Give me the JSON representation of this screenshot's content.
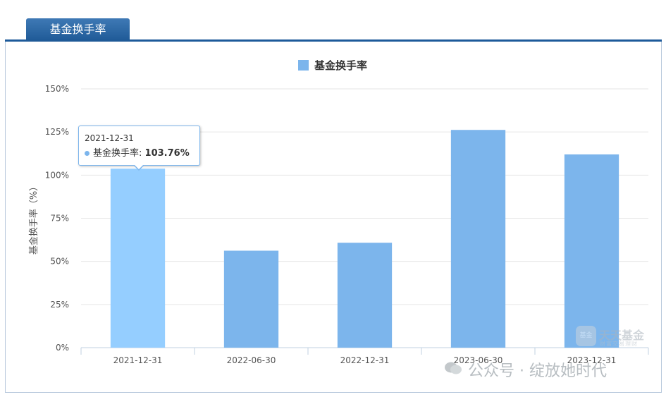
{
  "tab": {
    "label": "基金换手率"
  },
  "chart_data": {
    "type": "bar",
    "legend": "基金换手率",
    "legend_position": "top-center",
    "ylabel": "基金换手率（%）",
    "categories": [
      "2021-12-31",
      "2022-06-30",
      "2022-12-31",
      "2023-06-30",
      "2023-12-31"
    ],
    "series": [
      {
        "name": "基金换手率",
        "values": [
          103.76,
          56.2,
          60.8,
          126.2,
          112.0
        ]
      }
    ],
    "ylim": [
      0,
      150
    ],
    "yticks": [
      0,
      25,
      50,
      75,
      100,
      125,
      150
    ],
    "ytick_labels": [
      "0%",
      "25%",
      "50%",
      "75%",
      "100%",
      "125%",
      "150%"
    ],
    "grid": true,
    "bar_color": "#7cb5ec",
    "highlight_color": "#95ceff",
    "highlight_index": 0
  },
  "tooltip": {
    "date": "2021-12-31",
    "series": "基金换手率:",
    "value": "103.76%"
  },
  "watermarks": {
    "brand": "天天基金",
    "brand_badge": "基金",
    "brand_sub": "财富交易理财",
    "wechat": "公众号 · 绽放她时代"
  }
}
